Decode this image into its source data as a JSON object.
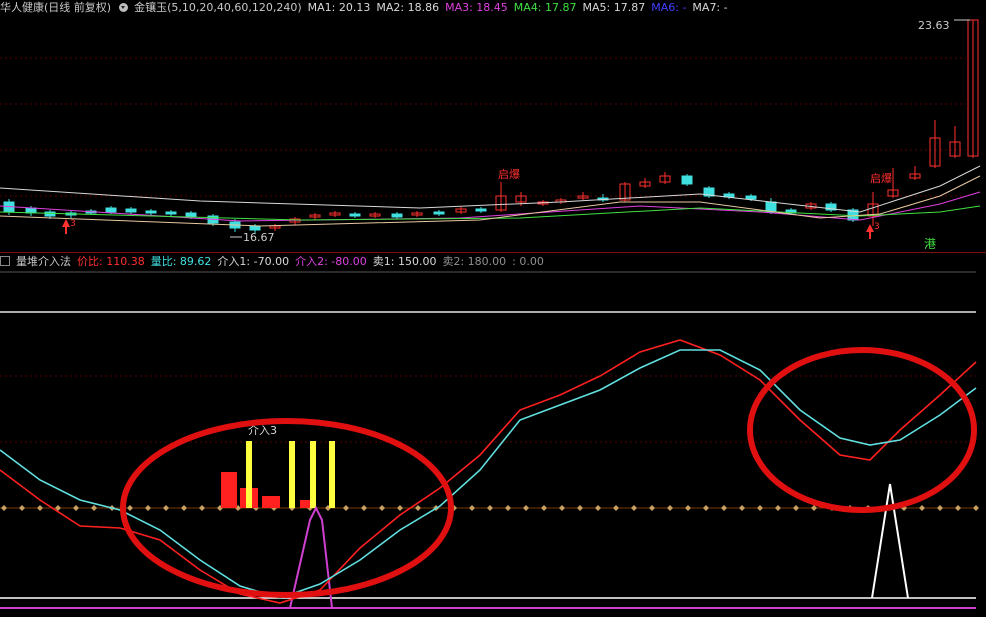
{
  "header": {
    "title": "华人健康(日线 前复权)",
    "indicator": "金镶玉(5,10,20,40,60,120,240)",
    "ma": [
      {
        "label": "MA1: 20.13",
        "color": "#d8d8d8"
      },
      {
        "label": "MA2: 18.86",
        "color": "#d8d8d8"
      },
      {
        "label": "MA3: 18.45",
        "color": "#e040e0"
      },
      {
        "label": "MA4: 17.87",
        "color": "#40e040"
      },
      {
        "label": "MA5: 17.87",
        "color": "#d8d8d8"
      },
      {
        "label": "MA6: -",
        "color": "#4040ff"
      },
      {
        "label": "MA7: -",
        "color": "#d8d8d8"
      }
    ]
  },
  "indicator_header": {
    "name": "量堆介入法",
    "items": [
      {
        "label": "价比: 110.38",
        "color": "#ff3030"
      },
      {
        "label": "量比: 89.62",
        "color": "#40e0e0"
      },
      {
        "label": "介入1: -70.00",
        "color": "#d8d8d8"
      },
      {
        "label": "介入2: -80.00",
        "color": "#e040e0"
      },
      {
        "label": "卖1: 150.00",
        "color": "#d8d8d8"
      },
      {
        "label": "卖2: 180.00",
        "color": "#909090"
      },
      {
        "label": ": 0.00",
        "color": "#909090"
      }
    ]
  },
  "price_labels": {
    "high": "23.63",
    "low": "16.67",
    "burst1": "启爆",
    "burst2": "启爆",
    "arrow_tag": "3",
    "port": "港"
  },
  "indicator_labels": {
    "entry": "介入3"
  },
  "colors": {
    "up": "#ff3030",
    "down": "#40e0e0",
    "price_line": "#ff2020",
    "volume_line": "#60e0e0",
    "entry_bar": "#ffff40",
    "ellipse": "#e01010",
    "spike_magenta": "#d040d0",
    "spike_white": "#ffffff"
  }
}
